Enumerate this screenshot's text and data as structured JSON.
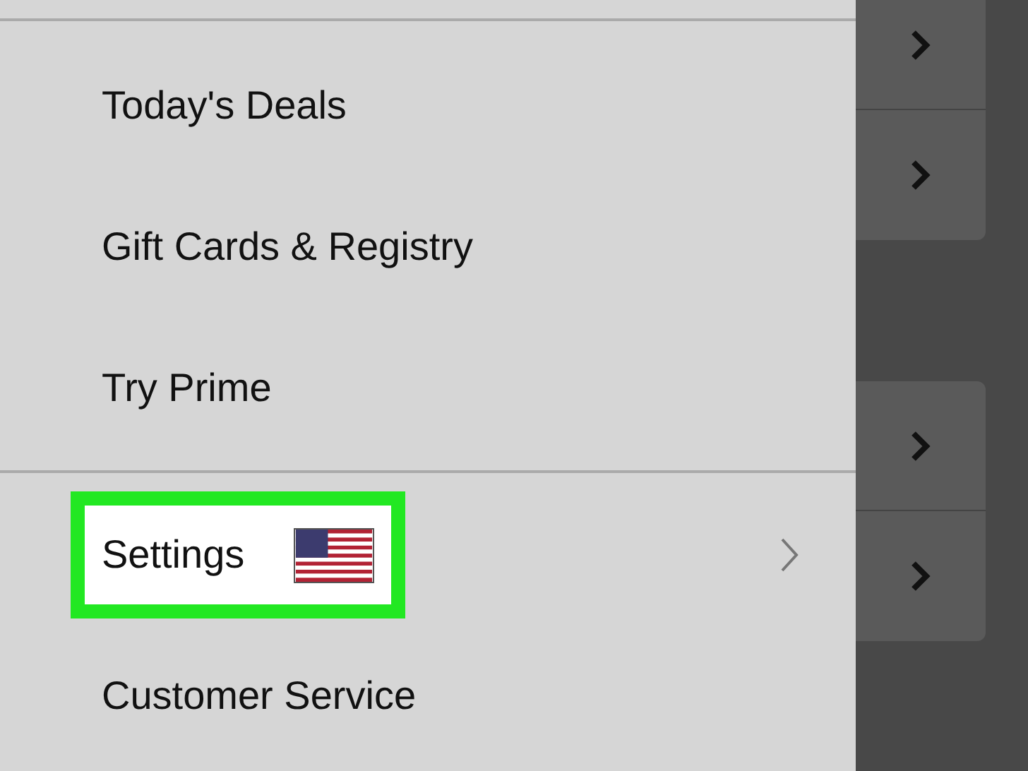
{
  "menu": {
    "top_items": [
      {
        "label": "Today's Deals",
        "highlighted": false,
        "flag": false,
        "chevron": false
      },
      {
        "label": "Gift Cards & Registry",
        "highlighted": false,
        "flag": false,
        "chevron": false
      },
      {
        "label": "Try Prime",
        "highlighted": false,
        "flag": false,
        "chevron": false
      }
    ],
    "bottom_items": [
      {
        "label": "Settings",
        "highlighted": true,
        "flag": true,
        "chevron": true
      },
      {
        "label": "Customer Service",
        "highlighted": false,
        "flag": false,
        "chevron": false
      }
    ]
  }
}
